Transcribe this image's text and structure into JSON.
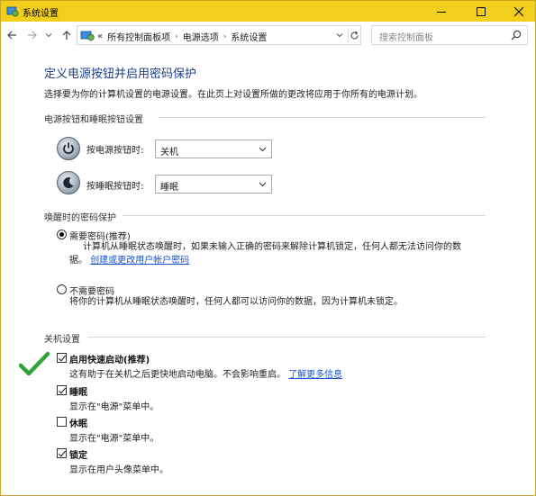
{
  "window": {
    "title": "系统设置",
    "accent_color": "#f2cf1c"
  },
  "address_bar": {
    "prefix": "«",
    "crumbs": [
      "所有控制面板项",
      "电源选项",
      "系统设置"
    ],
    "separator": "›",
    "search_placeholder": "搜索控制面板"
  },
  "page": {
    "heading": "定义电源按钮并启用密码保护",
    "description": "选择要为你的计算机设置的电源设置。在此页上对设置所做的更改将应用于你所有的电源计划。"
  },
  "buttons_section": {
    "title": "电源按钮和睡眠按钮设置",
    "rows": [
      {
        "label": "按电源按钮时:",
        "value": "关机",
        "icon": "power-icon"
      },
      {
        "label": "按睡眠按钮时:",
        "value": "睡眠",
        "icon": "sleep-icon"
      }
    ]
  },
  "password_section": {
    "title": "唤醒时的密码保护",
    "options": [
      {
        "label": "需要密码(推荐)",
        "selected": true,
        "text_line1": "计算机从睡眠状态唤醒时，如果未输入正确的密码来解除计算机锁定，任何人都无法访问你的数",
        "text_line2": "据。",
        "link": "创建或更改用户帐户密码"
      },
      {
        "label": "不需要密码",
        "selected": false,
        "text_line1": "将你的计算机从睡眠状态唤醒时，任何人都可以访问你的数据，因为计算机未锁定。"
      }
    ]
  },
  "shutdown_section": {
    "title": "关机设置",
    "items": [
      {
        "label": "启用快速启动(推荐)",
        "checked": true,
        "desc": "这有助于在关机之后更快地启动电脑。不会影响重启。",
        "link": "了解更多信息"
      },
      {
        "label": "睡眠",
        "checked": true,
        "desc": "显示在\"电源\"菜单中。"
      },
      {
        "label": "休眠",
        "checked": false,
        "desc": "显示在\"电源\"菜单中。"
      },
      {
        "label": "锁定",
        "checked": true,
        "desc": "显示在用户头像菜单中。"
      }
    ]
  },
  "colors": {
    "heading": "#1e3e8c",
    "link": "#1a56c9",
    "tick": "#2fa33a"
  }
}
